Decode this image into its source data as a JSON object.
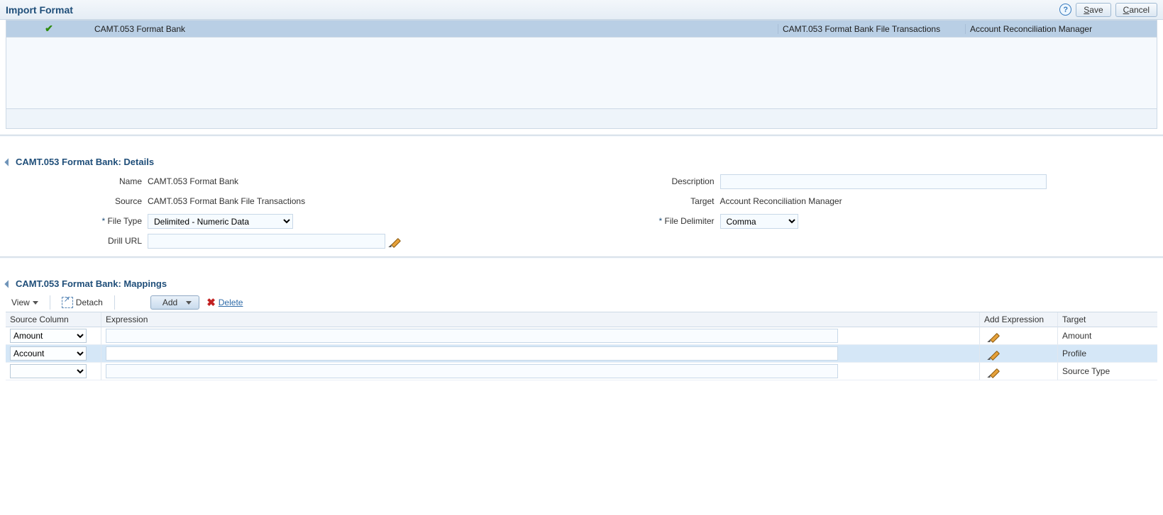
{
  "header": {
    "title": "Import Format",
    "save": "Save",
    "cancel": "Cancel"
  },
  "grid": {
    "row": {
      "name": "CAMT.053 Format Bank",
      "source": "CAMT.053 Format Bank File Transactions",
      "target": "Account Reconciliation Manager"
    }
  },
  "details": {
    "section_title": "CAMT.053 Format Bank: Details",
    "labels": {
      "name": "Name",
      "source": "Source",
      "file_type": "File Type",
      "drill_url": "Drill URL",
      "description": "Description",
      "target": "Target",
      "file_delimiter": "File Delimiter"
    },
    "values": {
      "name": "CAMT.053 Format Bank",
      "source": "CAMT.053 Format Bank File Transactions",
      "file_type": "Delimited - Numeric Data",
      "drill_url": "",
      "description": "",
      "target": "Account Reconciliation Manager",
      "file_delimiter": "Comma"
    }
  },
  "mappings": {
    "section_title": "CAMT.053 Format Bank: Mappings",
    "toolbar": {
      "view": "View",
      "detach": "Detach",
      "add": "Add",
      "delete": "Delete"
    },
    "headers": {
      "source_column": "Source Column",
      "expression": "Expression",
      "add_expression": "Add Expression",
      "target": "Target"
    },
    "rows": [
      {
        "source": "Amount",
        "expression": "",
        "target": "Amount"
      },
      {
        "source": "Account",
        "expression": "",
        "target": "Profile"
      },
      {
        "source": "",
        "expression": "",
        "target": "Source Type"
      }
    ]
  }
}
